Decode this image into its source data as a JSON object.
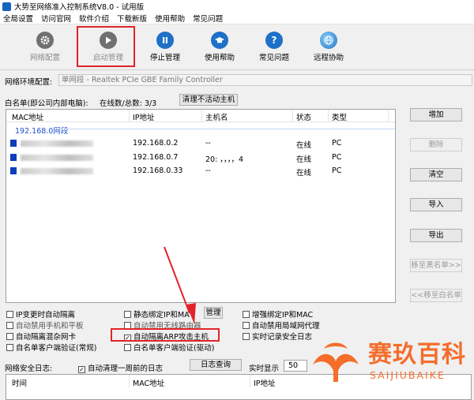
{
  "window": {
    "title": "大势至网络准入控制系统V8.0 - 试用版"
  },
  "menu": [
    "全局设置",
    "访问官网",
    "软件介绍",
    "下载新版",
    "使用帮助",
    "常见问题"
  ],
  "toolbar": [
    {
      "label": "网络配置",
      "icon": "gear-icon",
      "enabled": false
    },
    {
      "label": "启动管理",
      "icon": "play-icon",
      "enabled": false
    },
    {
      "label": "停止管理",
      "icon": "pause-icon",
      "enabled": true
    },
    {
      "label": "使用帮助",
      "icon": "graduation-cap-icon",
      "enabled": true
    },
    {
      "label": "常见问题",
      "icon": "question-icon",
      "enabled": true
    },
    {
      "label": "远程协助",
      "icon": "globe-icon",
      "enabled": true
    }
  ],
  "network": {
    "label": "网络环境配置:",
    "value": "单网段 - Realtek PCIe GBE Family Controller"
  },
  "whitelist": {
    "label": "白名单(即公司内部电脑):",
    "count_label": "在线数/总数:",
    "count_value": "3/3",
    "clear_button": "清理不活动主机",
    "columns": [
      "MAC地址",
      "IP地址",
      "主机名",
      "状态",
      "类型"
    ],
    "group": "192.168.0网段",
    "rows": [
      {
        "ip": "192.168.0.2",
        "host": "--",
        "status": "在线",
        "type": "PC"
      },
      {
        "ip": "192.168.0.7",
        "host": "20:  ，，，，4",
        "status": "在线",
        "type": "PC"
      },
      {
        "ip": "192.168.0.33",
        "host": "--",
        "status": "在线",
        "type": "PC"
      }
    ]
  },
  "side_buttons": [
    {
      "label": "增加",
      "enabled": true
    },
    {
      "label": "删除",
      "enabled": false
    },
    {
      "label": "清空",
      "enabled": true
    },
    {
      "label": "导入",
      "enabled": true
    },
    {
      "label": "导出",
      "enabled": true
    },
    {
      "label": "移至黑名单>>",
      "enabled": false
    },
    {
      "label": "<<移至白名单",
      "enabled": false
    }
  ],
  "options": {
    "col1": [
      {
        "label": "IP变更时自动隔离",
        "checked": false
      },
      {
        "label": "自动禁用手机和平板",
        "checked": false
      },
      {
        "label": "自动隔离混杂网卡",
        "checked": false
      },
      {
        "label": "自名单客户端验证(常规)",
        "checked": false
      }
    ],
    "col2": [
      {
        "label": "静态绑定IP和MA",
        "checked": false
      },
      {
        "label": "自动禁用无线路由器",
        "checked": false
      },
      {
        "label": "自动隔离ARP攻击主机",
        "checked": true
      },
      {
        "label": "白名单客户端验证(驱动)",
        "checked": false
      }
    ],
    "manage_button": "管理",
    "col3": [
      {
        "label": "增强绑定IP和MAC",
        "checked": false
      },
      {
        "label": "自动禁用局域网代理",
        "checked": false
      },
      {
        "label": "实时记录安全日志",
        "checked": false
      }
    ]
  },
  "log": {
    "label": "网络安全日志:",
    "auto_clean": "自动清理一周前的日志",
    "auto_clean_checked": true,
    "query_button": "日志查询",
    "realtime_label": "实时显示",
    "realtime_value": "50",
    "columns": [
      "时间",
      "MAC地址",
      "IP地址"
    ]
  },
  "watermark": {
    "cn": "赛玖百科",
    "en": "SAIJIUBAIKE"
  },
  "colors": {
    "highlight": "#e0242a",
    "accent": "#1e70c8",
    "watermark": "#f56d2b"
  }
}
